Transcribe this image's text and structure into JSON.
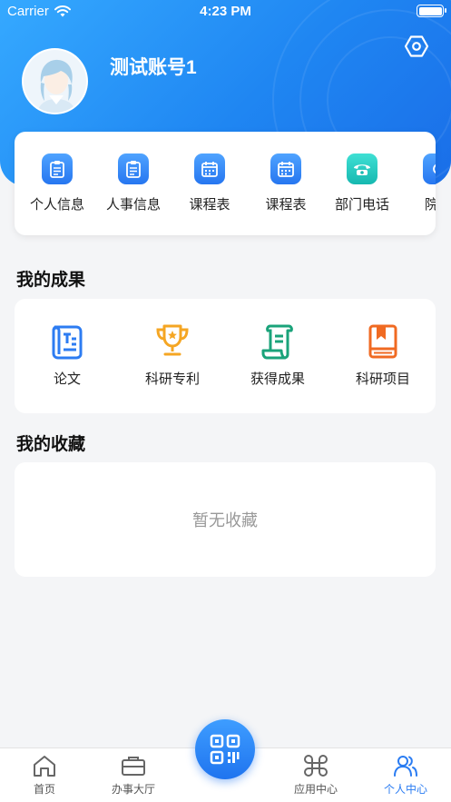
{
  "status_bar": {
    "carrier": "Carrier",
    "time": "4:23 PM"
  },
  "profile": {
    "account_name": "测试账号1"
  },
  "quick_links": [
    {
      "label": "个人信息",
      "icon": "clipboard-icon"
    },
    {
      "label": "人事信息",
      "icon": "clipboard-icon"
    },
    {
      "label": "课程表",
      "icon": "calendar-icon"
    },
    {
      "label": "课程表",
      "icon": "calendar-icon"
    },
    {
      "label": "部门电话",
      "icon": "phone-icon"
    },
    {
      "label": "院系",
      "icon": "partial-icon"
    }
  ],
  "achievements": {
    "title": "我的成果",
    "items": [
      {
        "label": "论文",
        "icon": "paper-icon",
        "color": "#2d7cf2"
      },
      {
        "label": "科研专利",
        "icon": "trophy-icon",
        "color": "#f5a623"
      },
      {
        "label": "获得成果",
        "icon": "scroll-icon",
        "color": "#1aa37a"
      },
      {
        "label": "科研项目",
        "icon": "book-icon",
        "color": "#f06a22"
      }
    ]
  },
  "favorites": {
    "title": "我的收藏",
    "empty_text": "暂无收藏"
  },
  "tabbar": {
    "tabs": [
      {
        "label": "首页",
        "icon": "home-icon"
      },
      {
        "label": "办事大厅",
        "icon": "briefcase-icon"
      },
      {
        "label": "应用中心",
        "icon": "command-icon"
      },
      {
        "label": "个人中心",
        "icon": "users-icon"
      }
    ],
    "active_tab": "个人中心",
    "center_icon": "qr-code-icon"
  },
  "colors": {
    "primary": "#2a7cf2",
    "header_gradient_start": "#35a9ff",
    "header_gradient_end": "#1a6ee8"
  }
}
